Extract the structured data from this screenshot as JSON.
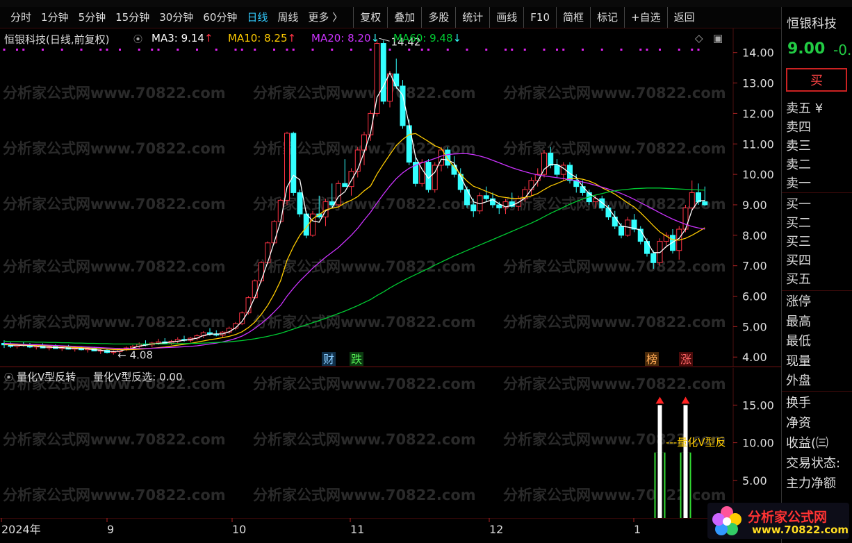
{
  "toolbar": {
    "periods": [
      "分时",
      "1分钟",
      "5分钟",
      "15分钟",
      "30分钟",
      "60分钟",
      "日线",
      "周线",
      "更多 〉"
    ],
    "active_period": "日线",
    "buttons": [
      "复权",
      "叠加",
      "多股",
      "统计",
      "画线",
      "F10",
      "简框",
      "标记",
      "+自选",
      "返回"
    ]
  },
  "main_legend": {
    "title": "恒银科技(日线,前复权)",
    "ma3": "MA3: 9.14",
    "ma10": "MA10: 8.25",
    "ma20": "MA20: 8.20",
    "ma60": "MA60: 9.48",
    "ma3_arrow": "↑",
    "ma10_arrow": "↑",
    "ma20_arrow": "↓",
    "ma60_arrow": "↓"
  },
  "indicator_legend": {
    "name": "量化V型反转",
    "value": "量化V型反选: 0.00",
    "signal_label": "量化V型反"
  },
  "annotations": {
    "high": "14.42",
    "low": "← 4.08",
    "marker_cai": "财",
    "marker_die": "跌",
    "marker_bang": "榜",
    "marker_zhang": "涨"
  },
  "watermark": "分析家公式网www.70822.com",
  "x_axis_labels": [
    "2024年",
    "9",
    "10",
    "11",
    "12",
    "1"
  ],
  "right_panel": {
    "stock_name": "恒银科技",
    "price": "9.00",
    "change": "-0.",
    "buy_button": "买",
    "sell_rows": [
      "卖五 ¥",
      "卖四",
      "卖三",
      "卖二",
      "卖一"
    ],
    "buy_rows": [
      "买一",
      "买二",
      "买三",
      "买四",
      "买五"
    ],
    "stats": [
      "涨停",
      "最高",
      "最低",
      "现量",
      "外盘"
    ],
    "extra": [
      "换手",
      "净资",
      "收益(㈢",
      "交易状态:",
      "主力净额"
    ]
  },
  "logo": {
    "name": "分析家公式网",
    "url": "www.70822.com"
  },
  "colors": {
    "up": "#ff3344",
    "down": "#33ffff",
    "ma3": "#ffffff",
    "ma10": "#ffcc00",
    "ma20": "#cc33ff",
    "ma60": "#00cc33",
    "signal_bar": "#33dd33"
  },
  "chart_data": [
    {
      "type": "candlestick",
      "title": "恒银科技(日线,前复权)",
      "y_ticks": [
        4.0,
        5.0,
        6.0,
        7.0,
        8.0,
        9.0,
        10.0,
        11.0,
        12.0,
        13.0,
        14.0
      ],
      "ylim": [
        3.8,
        14.7
      ],
      "period_labels": [
        "2024年",
        "9",
        "10",
        "11",
        "12",
        "1"
      ],
      "high_label": 14.42,
      "low_label": 4.08,
      "ohlc": [
        [
          4.45,
          4.55,
          4.3,
          4.4
        ],
        [
          4.4,
          4.48,
          4.3,
          4.35
        ],
        [
          4.35,
          4.45,
          4.28,
          4.42
        ],
        [
          4.42,
          4.5,
          4.35,
          4.38
        ],
        [
          4.38,
          4.46,
          4.3,
          4.33
        ],
        [
          4.33,
          4.4,
          4.25,
          4.36
        ],
        [
          4.36,
          4.45,
          4.3,
          4.3
        ],
        [
          4.3,
          4.38,
          4.22,
          4.34
        ],
        [
          4.34,
          4.42,
          4.28,
          4.28
        ],
        [
          4.28,
          4.35,
          4.2,
          4.32
        ],
        [
          4.32,
          4.4,
          4.25,
          4.26
        ],
        [
          4.26,
          4.33,
          4.18,
          4.3
        ],
        [
          4.3,
          4.36,
          4.22,
          4.24
        ],
        [
          4.24,
          4.3,
          4.15,
          4.28
        ],
        [
          4.28,
          4.34,
          4.2,
          4.2
        ],
        [
          4.2,
          4.26,
          4.1,
          4.22
        ],
        [
          4.22,
          4.28,
          4.12,
          4.15
        ],
        [
          4.15,
          4.22,
          4.08,
          4.18
        ],
        [
          4.18,
          4.3,
          4.12,
          4.26
        ],
        [
          4.26,
          4.35,
          4.2,
          4.3
        ],
        [
          4.3,
          4.4,
          4.25,
          4.35
        ],
        [
          4.35,
          4.48,
          4.3,
          4.42
        ],
        [
          4.42,
          4.55,
          4.36,
          4.4
        ],
        [
          4.4,
          4.5,
          4.32,
          4.46
        ],
        [
          4.46,
          4.6,
          4.4,
          4.5
        ],
        [
          4.5,
          4.62,
          4.42,
          4.45
        ],
        [
          4.45,
          4.56,
          4.4,
          4.52
        ],
        [
          4.52,
          4.65,
          4.45,
          4.58
        ],
        [
          4.58,
          4.7,
          4.5,
          4.55
        ],
        [
          4.55,
          4.66,
          4.48,
          4.62
        ],
        [
          4.62,
          4.75,
          4.55,
          4.7
        ],
        [
          4.7,
          4.85,
          4.62,
          4.8
        ],
        [
          4.8,
          4.95,
          4.7,
          4.75
        ],
        [
          4.75,
          4.88,
          4.68,
          4.72
        ],
        [
          4.72,
          4.85,
          4.65,
          4.82
        ],
        [
          4.82,
          5.0,
          4.76,
          4.95
        ],
        [
          4.95,
          5.15,
          4.88,
          5.1
        ],
        [
          5.1,
          5.5,
          5.05,
          5.45
        ],
        [
          5.45,
          6.0,
          5.4,
          5.95
        ],
        [
          5.95,
          6.55,
          5.9,
          6.5
        ],
        [
          6.5,
          7.15,
          6.45,
          7.1
        ],
        [
          7.1,
          7.8,
          7.05,
          7.75
        ],
        [
          7.75,
          8.5,
          7.7,
          8.45
        ],
        [
          8.45,
          9.2,
          8.4,
          9.15
        ],
        [
          9.15,
          11.4,
          9.0,
          11.35
        ],
        [
          11.35,
          11.4,
          9.3,
          9.4
        ],
        [
          9.4,
          9.5,
          8.6,
          8.7
        ],
        [
          8.7,
          8.8,
          7.9,
          8.0
        ],
        [
          8.0,
          8.8,
          7.95,
          8.7
        ],
        [
          8.7,
          9.3,
          8.55,
          8.6
        ],
        [
          8.6,
          9.2,
          8.3,
          9.1
        ],
        [
          9.1,
          9.7,
          8.9,
          9.0
        ],
        [
          9.0,
          9.8,
          8.95,
          9.7
        ],
        [
          9.7,
          10.5,
          9.6,
          9.6
        ],
        [
          9.6,
          10.2,
          9.3,
          10.1
        ],
        [
          10.1,
          10.9,
          9.9,
          10.8
        ],
        [
          10.8,
          11.4,
          10.3,
          11.3
        ],
        [
          11.3,
          12.1,
          11.1,
          12.0
        ],
        [
          12.0,
          14.42,
          11.9,
          14.3
        ],
        [
          14.3,
          14.4,
          12.3,
          12.4
        ],
        [
          12.4,
          13.4,
          12.2,
          13.3
        ],
        [
          13.3,
          13.8,
          12.8,
          12.9
        ],
        [
          12.9,
          13.1,
          11.5,
          11.6
        ],
        [
          11.6,
          11.8,
          10.3,
          10.4
        ],
        [
          10.4,
          10.6,
          9.6,
          9.7
        ],
        [
          9.7,
          10.5,
          9.6,
          10.4
        ],
        [
          10.4,
          10.5,
          9.4,
          9.5
        ],
        [
          9.5,
          10.4,
          9.4,
          10.3
        ],
        [
          10.3,
          10.9,
          10.1,
          10.8
        ],
        [
          10.8,
          10.9,
          10.2,
          10.3
        ],
        [
          10.3,
          10.6,
          9.9,
          10.0
        ],
        [
          10.0,
          10.2,
          9.4,
          9.5
        ],
        [
          9.5,
          9.6,
          8.9,
          9.0
        ],
        [
          9.0,
          9.2,
          8.6,
          8.8
        ],
        [
          8.8,
          9.4,
          8.7,
          9.3
        ],
        [
          9.3,
          9.6,
          9.1,
          9.2
        ],
        [
          9.2,
          9.4,
          8.9,
          9.0
        ],
        [
          9.0,
          9.1,
          8.7,
          8.9
        ],
        [
          8.9,
          9.2,
          8.7,
          9.1
        ],
        [
          9.1,
          9.4,
          8.9,
          8.95
        ],
        [
          8.95,
          9.3,
          8.8,
          9.2
        ],
        [
          9.2,
          9.6,
          9.1,
          9.5
        ],
        [
          9.5,
          9.9,
          9.3,
          9.8
        ],
        [
          9.8,
          10.2,
          9.6,
          10.0
        ],
        [
          10.0,
          10.8,
          9.9,
          10.7
        ],
        [
          10.7,
          10.9,
          10.2,
          10.3
        ],
        [
          10.3,
          10.5,
          9.9,
          10.0
        ],
        [
          10.0,
          10.4,
          9.8,
          10.3
        ],
        [
          10.3,
          10.4,
          9.7,
          9.8
        ],
        [
          9.8,
          10.0,
          9.4,
          9.6
        ],
        [
          9.6,
          9.8,
          9.3,
          9.4
        ],
        [
          9.4,
          9.5,
          9.0,
          9.1
        ],
        [
          9.1,
          9.3,
          8.9,
          9.2
        ],
        [
          9.2,
          9.3,
          8.8,
          8.9
        ],
        [
          8.9,
          9.0,
          8.5,
          8.6
        ],
        [
          8.6,
          8.8,
          8.2,
          8.3
        ],
        [
          8.3,
          8.4,
          7.9,
          8.0
        ],
        [
          8.0,
          8.6,
          7.95,
          8.5
        ],
        [
          8.5,
          8.7,
          8.1,
          8.2
        ],
        [
          8.2,
          8.3,
          7.7,
          7.8
        ],
        [
          7.8,
          7.9,
          7.3,
          7.4
        ],
        [
          7.4,
          7.5,
          6.9,
          7.1
        ],
        [
          7.1,
          7.9,
          7.0,
          7.8
        ],
        [
          7.8,
          8.1,
          7.6,
          8.0
        ],
        [
          8.0,
          8.2,
          7.4,
          7.5
        ],
        [
          7.5,
          8.3,
          7.2,
          8.2
        ],
        [
          8.2,
          9.0,
          8.1,
          8.9
        ],
        [
          8.9,
          9.8,
          8.8,
          9.4
        ],
        [
          9.4,
          9.7,
          9.0,
          9.1
        ],
        [
          9.1,
          9.6,
          8.95,
          9.0
        ]
      ],
      "series": [
        {
          "name": "MA3",
          "values": [
            4.43,
            4.39,
            4.39,
            4.38,
            4.38,
            4.36,
            4.33,
            4.33,
            4.31,
            4.31,
            4.29,
            4.29,
            4.27,
            4.27,
            4.24,
            4.23,
            4.19,
            4.18,
            4.2,
            4.25,
            4.3,
            4.36,
            4.39,
            4.43,
            4.45,
            4.47,
            4.49,
            4.52,
            4.55,
            4.58,
            4.62,
            4.71,
            4.75,
            4.76,
            4.76,
            4.83,
            4.96,
            5.17,
            5.5,
            5.97,
            6.52,
            7.12,
            7.77,
            8.45,
            9.58,
            9.97,
            9.82,
            8.7,
            8.47,
            8.43,
            8.8,
            8.9,
            9.27,
            9.43,
            9.8,
            10.17,
            10.73,
            11.37,
            12.53,
            12.9,
            13.33,
            12.87,
            12.6,
            11.63,
            10.57,
            10.17,
            9.87,
            10.07,
            10.5,
            10.47,
            10.37,
            9.93,
            9.5,
            9.1,
            9.03,
            9.1,
            9.17,
            9.03,
            8.93,
            8.98,
            9.08,
            9.22,
            9.5,
            9.77,
            10.17,
            10.33,
            10.33,
            10.2,
            10.03,
            9.9,
            9.6,
            9.37,
            9.23,
            9.07,
            8.9,
            8.6,
            8.3,
            8.27,
            8.23,
            8.17,
            7.8,
            7.43,
            7.43,
            7.63,
            7.77,
            7.9,
            8.2,
            8.83,
            9.13,
            9.14
          ]
        },
        {
          "name": "MA10",
          "values": [
            4.42,
            4.41,
            4.41,
            4.4,
            4.4,
            4.39,
            4.38,
            4.37,
            4.36,
            4.35,
            4.33,
            4.32,
            4.31,
            4.3,
            4.29,
            4.28,
            4.26,
            4.25,
            4.25,
            4.24,
            4.25,
            4.26,
            4.27,
            4.29,
            4.31,
            4.33,
            4.36,
            4.39,
            4.42,
            4.45,
            4.49,
            4.53,
            4.57,
            4.6,
            4.64,
            4.68,
            4.74,
            4.83,
            4.97,
            5.15,
            5.4,
            5.7,
            6.07,
            6.51,
            7.18,
            7.63,
            8.0,
            8.26,
            8.54,
            8.68,
            8.83,
            8.89,
            8.93,
            9.06,
            9.15,
            9.27,
            9.46,
            9.62,
            10.01,
            10.34,
            10.65,
            10.95,
            11.15,
            11.31,
            11.34,
            11.21,
            11.08,
            10.94,
            10.85,
            10.5,
            10.25,
            10.0,
            9.78,
            9.61,
            9.53,
            9.44,
            9.36,
            9.27,
            9.24,
            9.21,
            9.21,
            9.24,
            9.29,
            9.37,
            9.5,
            9.62,
            9.7,
            9.79,
            9.86,
            9.87,
            9.84,
            9.78,
            9.69,
            9.56,
            9.46,
            9.35,
            9.21,
            9.06,
            8.93,
            8.74,
            8.53,
            8.31,
            8.11,
            7.97,
            7.85,
            7.84,
            7.9,
            8.0,
            8.12,
            8.25
          ]
        },
        {
          "name": "MA20",
          "values": [
            4.45,
            4.44,
            4.43,
            4.42,
            4.41,
            4.41,
            4.4,
            4.39,
            4.38,
            4.37,
            4.36,
            4.35,
            4.34,
            4.33,
            4.32,
            4.31,
            4.3,
            4.29,
            4.28,
            4.28,
            4.28,
            4.28,
            4.28,
            4.29,
            4.3,
            4.31,
            4.32,
            4.33,
            4.34,
            4.35,
            4.37,
            4.4,
            4.43,
            4.46,
            4.5,
            4.55,
            4.61,
            4.69,
            4.8,
            4.94,
            5.1,
            5.28,
            5.48,
            5.7,
            6.0,
            6.26,
            6.5,
            6.71,
            6.92,
            7.1,
            7.28,
            7.44,
            7.6,
            7.8,
            8.0,
            8.23,
            8.5,
            8.76,
            9.06,
            9.35,
            9.62,
            9.86,
            10.05,
            10.2,
            10.3,
            10.38,
            10.45,
            10.52,
            10.6,
            10.65,
            10.67,
            10.68,
            10.68,
            10.65,
            10.6,
            10.54,
            10.46,
            10.38,
            10.3,
            10.22,
            10.15,
            10.09,
            10.03,
            9.98,
            9.95,
            9.92,
            9.89,
            9.86,
            9.83,
            9.79,
            9.75,
            9.7,
            9.64,
            9.58,
            9.52,
            9.45,
            9.37,
            9.28,
            9.18,
            9.07,
            8.96,
            8.85,
            8.74,
            8.63,
            8.53,
            8.44,
            8.36,
            8.29,
            8.24,
            8.2
          ]
        },
        {
          "name": "MA60",
          "values": [
            4.52,
            4.51,
            4.51,
            4.5,
            4.5,
            4.49,
            4.49,
            4.48,
            4.48,
            4.47,
            4.47,
            4.46,
            4.46,
            4.45,
            4.45,
            4.44,
            4.44,
            4.43,
            4.43,
            4.43,
            4.43,
            4.43,
            4.43,
            4.43,
            4.43,
            4.43,
            4.44,
            4.44,
            4.44,
            4.45,
            4.45,
            4.46,
            4.47,
            4.48,
            4.49,
            4.5,
            4.52,
            4.54,
            4.57,
            4.6,
            4.64,
            4.68,
            4.73,
            4.78,
            4.85,
            4.92,
            4.99,
            5.06,
            5.13,
            5.2,
            5.27,
            5.35,
            5.43,
            5.51,
            5.6,
            5.69,
            5.79,
            5.89,
            6.02,
            6.14,
            6.27,
            6.39,
            6.5,
            6.61,
            6.71,
            6.81,
            6.91,
            7.02,
            7.12,
            7.22,
            7.32,
            7.41,
            7.5,
            7.59,
            7.68,
            7.77,
            7.86,
            7.95,
            8.04,
            8.13,
            8.22,
            8.31,
            8.4,
            8.5,
            8.61,
            8.72,
            8.82,
            8.92,
            9.02,
            9.11,
            9.19,
            9.26,
            9.32,
            9.37,
            9.42,
            9.46,
            9.49,
            9.51,
            9.53,
            9.54,
            9.55,
            9.55,
            9.55,
            9.54,
            9.53,
            9.52,
            9.51,
            9.5,
            9.49,
            9.48
          ]
        }
      ]
    },
    {
      "type": "bar",
      "title": "量化V型反转",
      "y_ticks": [
        5.0,
        10.0,
        15.0
      ],
      "ylim": [
        0,
        19
      ],
      "series": [
        {
          "name": "量化V型反选",
          "signals": [
            {
              "index": 102,
              "value": 15.0
            },
            {
              "index": 106,
              "value": 15.0
            }
          ]
        }
      ]
    }
  ]
}
